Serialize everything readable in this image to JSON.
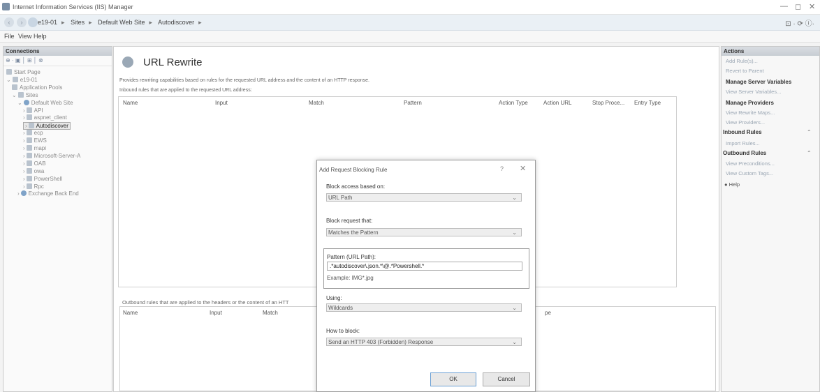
{
  "window": {
    "title": "Internet Information Services (IIS) Manager",
    "minimize": "—",
    "restore": "◻",
    "close": "✕"
  },
  "address_bar": {
    "back": "‹",
    "forward": "›",
    "crumbs": [
      "e19-01",
      "Sites",
      "Default Web Site",
      "Autodiscover"
    ],
    "right_tools": "⊡ · ⟳ ⓘ·"
  },
  "menu": {
    "items": [
      "File",
      "View",
      "Help"
    ]
  },
  "connections": {
    "header": "Connections",
    "toolbar": "⊕ · ▣ │ ⊞ │ ⊗",
    "tree": [
      {
        "label": "Start Page",
        "icon": "server-icon"
      },
      {
        "label": "e19-01",
        "icon": "server-icon",
        "twisty": "⌄"
      },
      {
        "label": "Application Pools",
        "icon": "app-pool-icon"
      },
      {
        "label": "Sites",
        "icon": "folder-icon",
        "twisty": "⌄"
      },
      {
        "label": "Default Web Site",
        "icon": "globe-icon",
        "twisty": "⌄"
      },
      {
        "label": "API",
        "icon": "app-icon",
        "twisty": "›"
      },
      {
        "label": "aspnet_client",
        "icon": "folder-icon",
        "twisty": "›"
      },
      {
        "label": "Autodiscover",
        "icon": "app-icon",
        "twisty": "›",
        "selected": true
      },
      {
        "label": "ecp",
        "icon": "app-icon",
        "twisty": "›"
      },
      {
        "label": "EWS",
        "icon": "app-icon",
        "twisty": "›"
      },
      {
        "label": "mapi",
        "icon": "app-icon",
        "twisty": "›"
      },
      {
        "label": "Microsoft-Server-A",
        "icon": "app-icon",
        "twisty": "›"
      },
      {
        "label": "OAB",
        "icon": "app-icon",
        "twisty": "›"
      },
      {
        "label": "owa",
        "icon": "app-icon",
        "twisty": "›"
      },
      {
        "label": "PowerShell",
        "icon": "app-icon",
        "twisty": "›"
      },
      {
        "label": "Rpc",
        "icon": "app-icon",
        "twisty": "›"
      },
      {
        "label": "Exchange Back End",
        "icon": "globe-icon",
        "twisty": "›"
      }
    ]
  },
  "main": {
    "title": "URL Rewrite",
    "description": "Provides rewriting capabilities based on rules for the requested URL address and the content of an HTTP response.",
    "inbound_label": "Inbound rules that are applied to the requested URL address:",
    "inbound_columns": [
      "Name",
      "Input",
      "Match",
      "Pattern",
      "Action Type",
      "Action URL",
      "Stop Proce...",
      "Entry Type"
    ],
    "outbound_label": "Outbound rules that are applied to the headers or the content of an HTT",
    "outbound_columns": [
      "Name",
      "Input",
      "Match"
    ],
    "outbound_col_tail": "pe"
  },
  "actions": {
    "header": "Actions",
    "items": [
      {
        "label": "Add Rule(s)...",
        "kind": "link"
      },
      {
        "label": "Revert to Parent",
        "kind": "link"
      },
      {
        "label": "Manage Server Variables",
        "kind": "bold"
      },
      {
        "label": "View Server Variables...",
        "kind": "link"
      },
      {
        "label": "Manage Providers",
        "kind": "bold"
      },
      {
        "label": "View Rewrite Maps...",
        "kind": "link"
      },
      {
        "label": "View Providers...",
        "kind": "link"
      },
      {
        "label": "Inbound Rules",
        "kind": "section"
      },
      {
        "label": "Import Rules...",
        "kind": "link"
      },
      {
        "label": "Outbound Rules",
        "kind": "section"
      },
      {
        "label": "View Preconditions...",
        "kind": "link"
      },
      {
        "label": "View Custom Tags...",
        "kind": "link"
      },
      {
        "label": "Help",
        "kind": "help"
      }
    ]
  },
  "dialog": {
    "title": "Add Request Blocking Rule",
    "help": "?",
    "close": "✕",
    "block_access_label": "Block access based on:",
    "block_access_value": "URL Path",
    "block_request_label": "Block request that:",
    "block_request_value": "Matches the Pattern",
    "pattern_label": "Pattern (URL Path):",
    "pattern_value": ".*autodiscover\\.json.*\\@.*Powershell.*",
    "example": "Example: IMG*.jpg",
    "using_label": "Using:",
    "using_value": "Wildcards",
    "how_label": "How to block:",
    "how_value": "Send an HTTP 403 (Forbidden) Response",
    "ok": "OK",
    "cancel": "Cancel"
  }
}
